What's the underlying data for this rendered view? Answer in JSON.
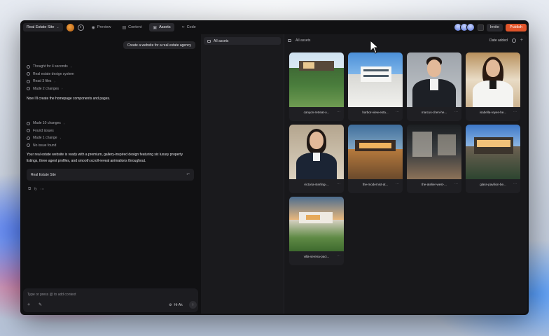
{
  "topbar": {
    "site_name": "Real Estate Site",
    "tabs": [
      {
        "label": "Preview",
        "icon": "eye-icon"
      },
      {
        "label": "Content",
        "icon": "layers-icon"
      },
      {
        "label": "Assets",
        "icon": "image-icon",
        "active": true
      },
      {
        "label": "Code",
        "icon": "code-icon"
      }
    ],
    "invite_label": "Invite",
    "publish_label": "Publish",
    "publish_color": "#e0542a"
  },
  "chat": {
    "user_message": "Create a website for a real estate agency",
    "steps_a": [
      "Thought for 4 seconds",
      "Real estate design system",
      "Read 3 files",
      "Made 2 changes"
    ],
    "paragraph_1": "Now I'll create the homepage components and pages.",
    "steps_b": [
      "Made 10 changes",
      "Found issues",
      "Made 1 change",
      "No issue found"
    ],
    "paragraph_2": "Your real estate website is ready with a premium, gallery-inspired design featuring six luxury property listings, three agent profiles, and smooth scroll-reveal animations throughout.",
    "version_card": "Real Estate Site",
    "input_placeholder": "Type or press @ to add context",
    "model_label": "Hi-Ak"
  },
  "assets": {
    "folder_label": "All assets",
    "header_label": "All assets",
    "sort_label": "Date added",
    "tiles": [
      {
        "name": "canyon-retreat-o...",
        "kind": "house-a"
      },
      {
        "name": "harbor-view-esta...",
        "kind": "house-b"
      },
      {
        "name": "marcus-chen-he...",
        "kind": "portrait-man"
      },
      {
        "name": "isabella-reyes-he...",
        "kind": "portrait-woman-a"
      },
      {
        "name": "victoria-sterling-...",
        "kind": "portrait-woman-b"
      },
      {
        "name": "the-modernist-at...",
        "kind": "house-c"
      },
      {
        "name": "the-atelier-west-...",
        "kind": "house-e"
      },
      {
        "name": "glass-pavilion-be...",
        "kind": "house-f"
      },
      {
        "name": "villa-serena-paci...",
        "kind": "house-g"
      }
    ]
  }
}
